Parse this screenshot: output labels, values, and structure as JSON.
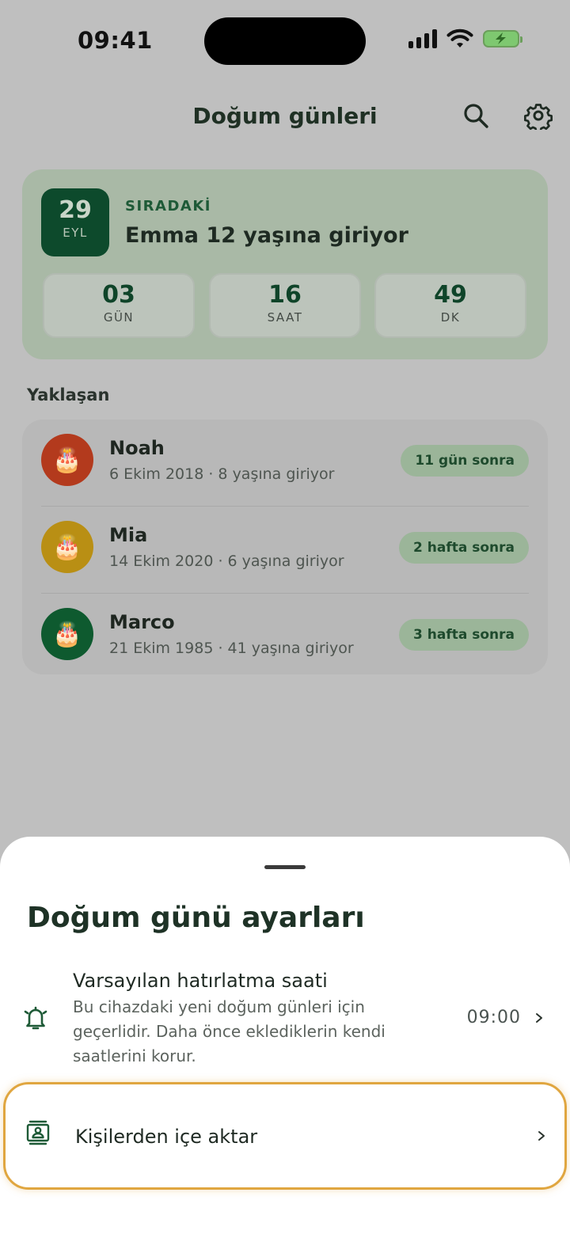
{
  "status_bar": {
    "time": "09:41"
  },
  "header": {
    "title": "Doğum günleri"
  },
  "next": {
    "day": "29",
    "month": "EYL",
    "label": "SIRADAKİ",
    "title": "Emma 12 yaşına giriyor",
    "countdown": [
      {
        "value": "03",
        "unit": "GÜN"
      },
      {
        "value": "16",
        "unit": "SAAT"
      },
      {
        "value": "49",
        "unit": "DK"
      }
    ]
  },
  "upcoming": {
    "title": "Yaklaşan",
    "items": [
      {
        "name": "Noah",
        "sub": "6 Ekim 2018 · 8 yaşına giriyor",
        "badge": "11 gün sonra",
        "color": "#b33a1d",
        "icon": "cake-icon"
      },
      {
        "name": "Mia",
        "sub": "14 Ekim 2020 · 6 yaşına giriyor",
        "badge": "2 hafta sonra",
        "color": "#b98f14",
        "icon": "cake-icon"
      },
      {
        "name": "Marco",
        "sub": "21 Ekim 1985 · 41 yaşına giriyor",
        "badge": "3 hafta sonra",
        "color": "#0e5a2f",
        "icon": "cake-icon"
      }
    ]
  },
  "sheet": {
    "title": "Doğum günü ayarları",
    "reminder": {
      "title": "Varsayılan hatırlatma saati",
      "desc": "Bu cihazdaki yeni doğum günleri için geçerlidir. Daha önce eklediklerin kendi saatlerini korur.",
      "value": "09:00"
    },
    "import": {
      "title": "Kişilerden içe aktar"
    }
  },
  "colors": {
    "accent": "#0d4a2c",
    "highlight": "#e0a640"
  }
}
